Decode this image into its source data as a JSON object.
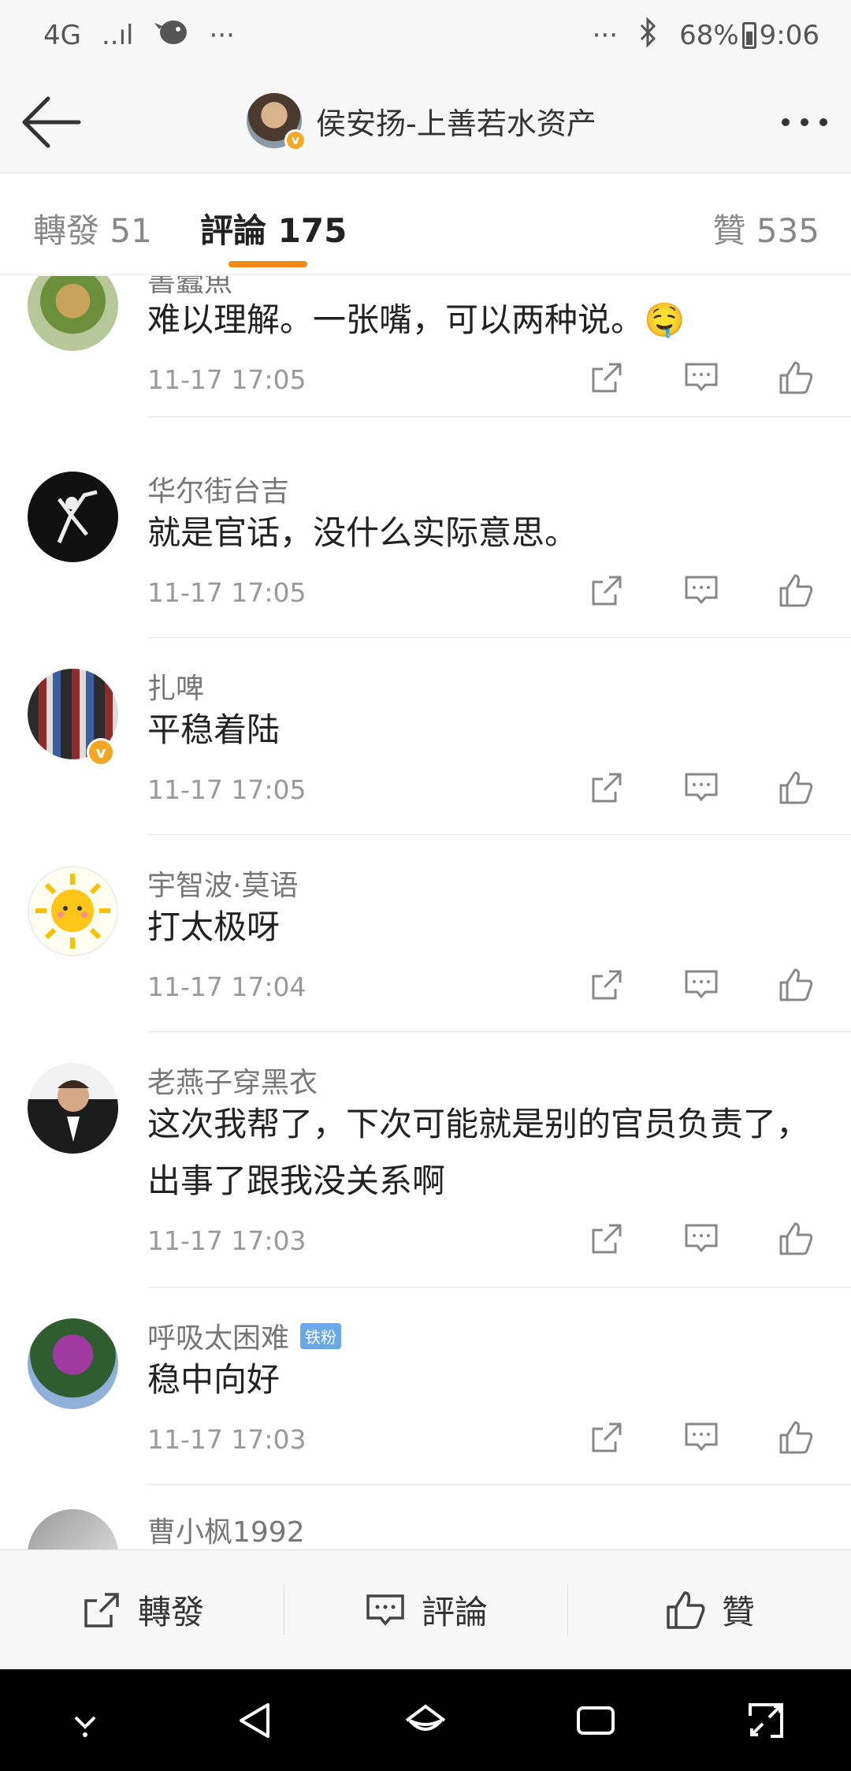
{
  "status_bar": {
    "network": "4G",
    "signal": "..ıl",
    "dots_left": "···",
    "dots_right": "···",
    "bluetooth": "∦",
    "battery": "68%",
    "time": "9:06"
  },
  "header": {
    "title": "侯安扬-上善若水资产",
    "verified_badge": "v"
  },
  "tabs": {
    "repost": "轉發 51",
    "comments": "評論 175",
    "likes": "贊 535"
  },
  "comments": [
    {
      "user": "書蠹魚",
      "text": "难以理解。一张嘴，可以两种说。🤤",
      "time": "11-17 17:05"
    },
    {
      "user": "华尔街台吉",
      "text": "就是官话，没什么实际意思。",
      "time": "11-17 17:05"
    },
    {
      "user": "扎啤",
      "text": "平稳着陆",
      "time": "11-17 17:05",
      "verified": "v"
    },
    {
      "user": "宇智波·莫语",
      "text": "打太极呀",
      "time": "11-17 17:04"
    },
    {
      "user": "老燕子穿黑衣",
      "text": "这次我帮了，下次可能就是别的官员负责了，出事了跟我没关系啊",
      "time": "11-17 17:03"
    },
    {
      "user": "呼吸太困难",
      "badge": "铁粉",
      "text": "稳中向好",
      "time": "11-17 17:03"
    },
    {
      "user": "曹小枫1992"
    }
  ],
  "bottom_bar": {
    "repost": "轉發",
    "comment": "評論",
    "like": "贊"
  },
  "colors": {
    "accent": "#f08a16",
    "verified": "#f5a623",
    "iron_fan": "#6aa8e8"
  }
}
